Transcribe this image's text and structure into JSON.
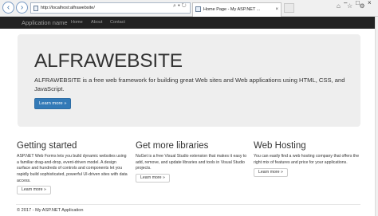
{
  "browser": {
    "address": "http://localhost:alfrawebsite/",
    "address_tools": "⌕ ▾ ↻",
    "tab_title": "Home Page - My ASP.NET ...",
    "tab_close": "×",
    "back_icon": "arrow-left-icon",
    "forward_icon": "arrow-right-icon",
    "tool_glyphs": "⌂ ☆ ⚙",
    "window_controls": {
      "minimize": "–",
      "maximize": "□",
      "close": "×"
    }
  },
  "navbar": {
    "brand": "Application name",
    "links": [
      "Home",
      "About",
      "Contact"
    ]
  },
  "jumbotron": {
    "title": "ALFRAWEBSITE",
    "lead": "ALFRAWEBSITE is a free web framework for building great Web sites and Web applications using HTML, CSS, and JavaScript.",
    "button": "Learn more »"
  },
  "columns": [
    {
      "heading": "Getting started",
      "text": "ASP.NET Web Forms lets you build dynamic websites using a familiar drag-and-drop, event-driven model. A design surface and hundreds of controls and components let you rapidly build sophisticated, powerful UI-driven sites with data access.",
      "button": "Learn more »"
    },
    {
      "heading": "Get more libraries",
      "text": "NuGet is a free Visual Studio extension that makes it easy to add, remove, and update libraries and tools in Visual Studio projects.",
      "button": "Learn more »"
    },
    {
      "heading": "Web Hosting",
      "text": "You can easily find a web hosting company that offers the right mix of features and price for your applications.",
      "button": "Learn more »"
    }
  ],
  "footer": "© 2017 - My ASP.NET Application",
  "colors": {
    "navbar": "#222222",
    "jumbotron": "#eeeeee",
    "primary": "#337ab7"
  }
}
